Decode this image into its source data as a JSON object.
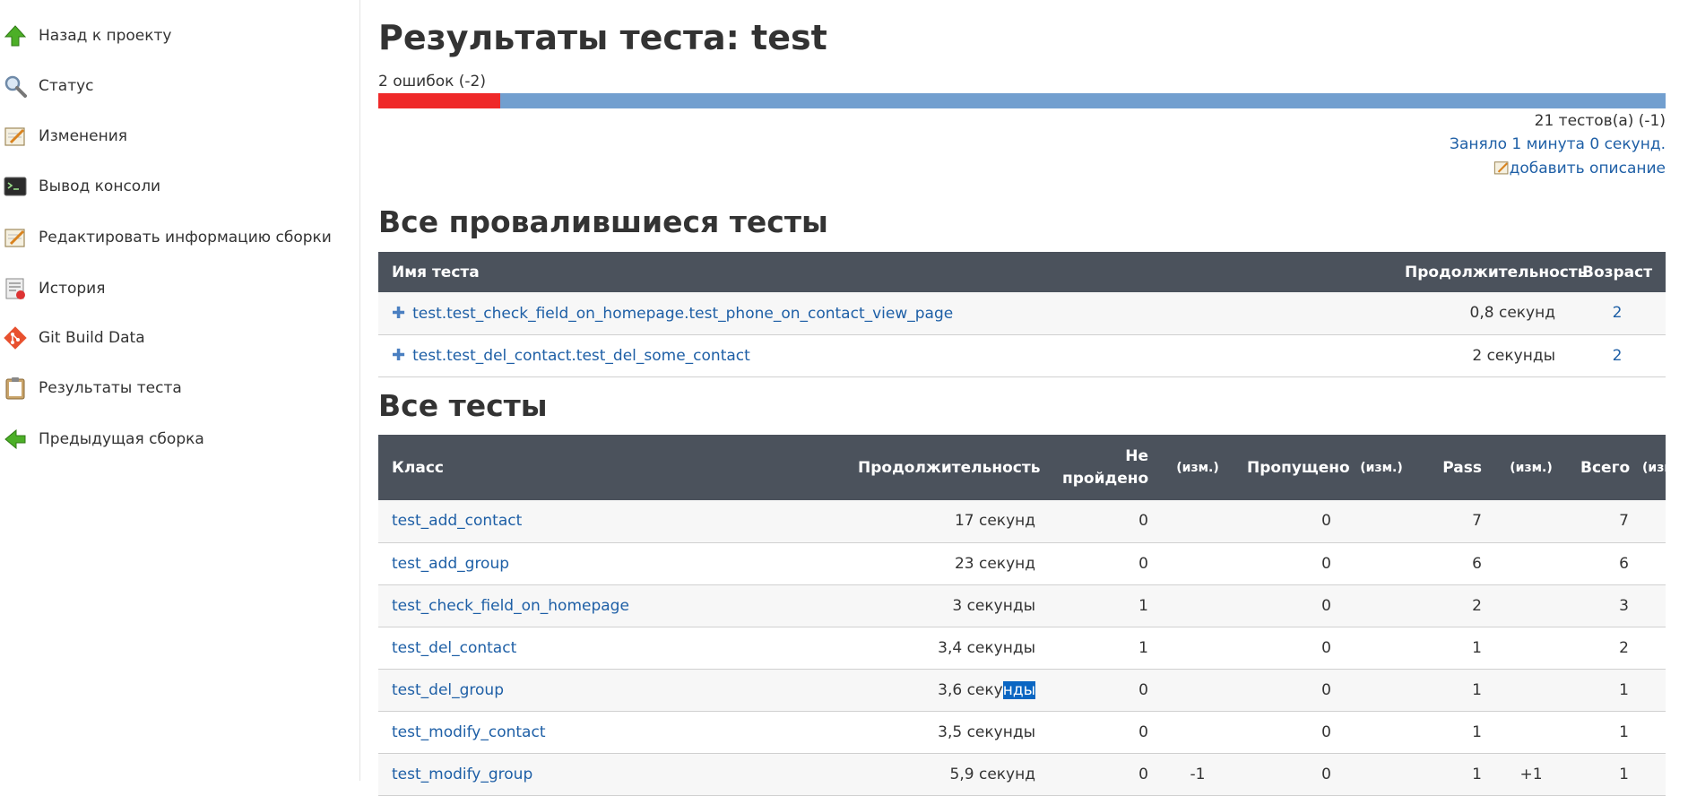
{
  "sidebar": {
    "items": [
      {
        "label": "Назад к проекту",
        "icon": "up-arrow-icon"
      },
      {
        "label": "Статус",
        "icon": "magnifier-icon"
      },
      {
        "label": "Изменения",
        "icon": "notepad-icon"
      },
      {
        "label": "Вывод консоли",
        "icon": "terminal-icon"
      },
      {
        "label": "Редактировать информацию сборки",
        "icon": "notepad-icon"
      },
      {
        "label": "История",
        "icon": "history-icon"
      },
      {
        "label": "Git Build Data",
        "icon": "git-icon"
      },
      {
        "label": "Результаты теста",
        "icon": "clipboard-icon"
      },
      {
        "label": "Предыдущая сборка",
        "icon": "left-arrow-icon"
      }
    ]
  },
  "header": {
    "title": "Результаты теста: test",
    "fail_summary": "2 ошибок (-2)",
    "fail_fraction": 0.095,
    "tests_count": "21 тестов(а) (-1)",
    "duration": "Заняло 1 минута 0 секунд.",
    "add_description": "добавить описание"
  },
  "colors": {
    "fail": "#ef2929",
    "pass": "#729fcf",
    "link": "#1e5fa6",
    "table_header": "#4b525c"
  },
  "failed": {
    "heading": "Все провалившиеся тесты",
    "columns": [
      "Имя теста",
      "Продолжительность",
      "Возраст"
    ],
    "rows": [
      {
        "name": "test.test_check_field_on_homepage.test_phone_on_contact_view_page",
        "duration": "0,8 секунд",
        "age": "2"
      },
      {
        "name": "test.test_del_contact.test_del_some_contact",
        "duration": "2 секунды",
        "age": "2"
      }
    ]
  },
  "all": {
    "heading": "Все тесты",
    "columns": {
      "klass": "Класс",
      "duration": "Продолжительность",
      "failed_l1": "Не",
      "failed_l2": "пройдено",
      "diff": "(изм.)",
      "skipped": "Пропущено",
      "pass": "Pass",
      "total": "Всего"
    },
    "rows": [
      {
        "klass": "test_add_contact",
        "duration": "17 секунд",
        "failed": "0",
        "failed_diff": "",
        "skipped": "0",
        "skipped_diff": "",
        "pass": "7",
        "pass_diff": "",
        "total": "7",
        "total_diff": ""
      },
      {
        "klass": "test_add_group",
        "duration": "23 секунд",
        "failed": "0",
        "failed_diff": "",
        "skipped": "0",
        "skipped_diff": "",
        "pass": "6",
        "pass_diff": "",
        "total": "6",
        "total_diff": ""
      },
      {
        "klass": "test_check_field_on_homepage",
        "duration": "3 секунды",
        "failed": "1",
        "failed_diff": "",
        "skipped": "0",
        "skipped_diff": "",
        "pass": "2",
        "pass_diff": "",
        "total": "3",
        "total_diff": ""
      },
      {
        "klass": "test_del_contact",
        "duration": "3,4 секунды",
        "failed": "1",
        "failed_diff": "",
        "skipped": "0",
        "skipped_diff": "",
        "pass": "1",
        "pass_diff": "",
        "total": "2",
        "total_diff": ""
      },
      {
        "klass": "test_del_group",
        "duration_a": "3,6 секу",
        "duration_b": "нды",
        "failed": "0",
        "failed_diff": "",
        "skipped": "0",
        "skipped_diff": "",
        "pass": "1",
        "pass_diff": "",
        "total": "1",
        "total_diff": ""
      },
      {
        "klass": "test_modify_contact",
        "duration": "3,5 секунды",
        "failed": "0",
        "failed_diff": "",
        "skipped": "0",
        "skipped_diff": "",
        "pass": "1",
        "pass_diff": "",
        "total": "1",
        "total_diff": ""
      },
      {
        "klass": "test_modify_group",
        "duration": "5,9 секунд",
        "failed": "0",
        "failed_diff": "-1",
        "skipped": "0",
        "skipped_diff": "",
        "pass": "1",
        "pass_diff": "+1",
        "total": "1",
        "total_diff": ""
      }
    ]
  }
}
